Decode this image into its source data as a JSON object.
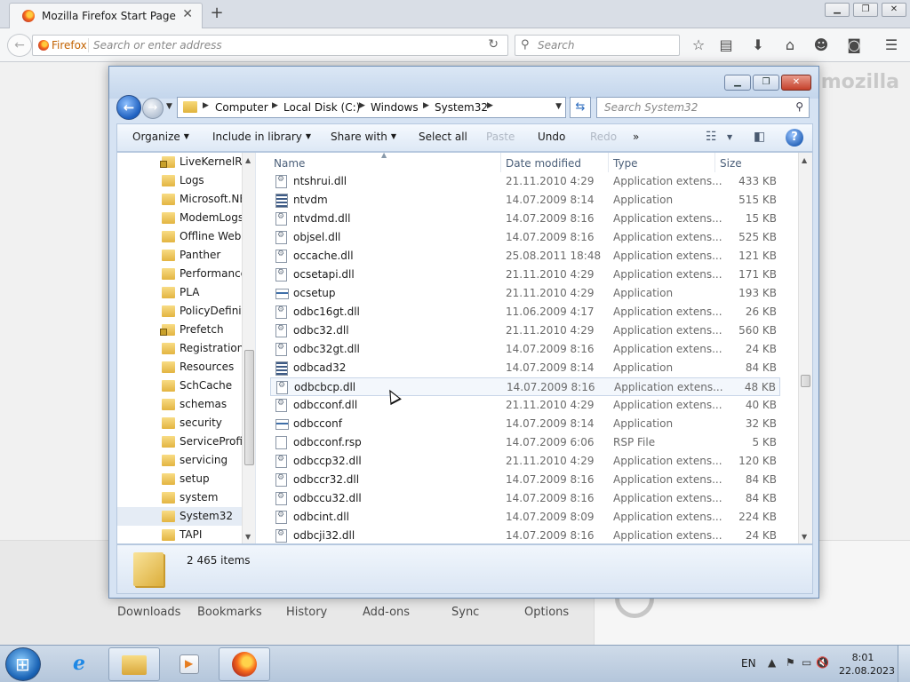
{
  "firefox": {
    "tab_title": "Mozilla Firefox Start Page",
    "identity_label": "Firefox",
    "url_placeholder": "Search or enter address",
    "search_placeholder": "Search",
    "brand": "mozilla",
    "launch": [
      "Downloads",
      "Bookmarks",
      "History",
      "Add-ons",
      "Sync",
      "Options"
    ]
  },
  "explorer": {
    "breadcrumb": [
      "Computer",
      "Local Disk (C:)",
      "Windows",
      "System32"
    ],
    "search_placeholder": "Search System32",
    "commands": {
      "organize": "Organize",
      "include": "Include in library",
      "share": "Share with",
      "select_all": "Select all",
      "paste": "Paste",
      "undo": "Undo",
      "redo": "Redo",
      "more": "»"
    },
    "nav_items": [
      {
        "label": "LiveKernelRep",
        "locked": true
      },
      {
        "label": "Logs",
        "locked": false
      },
      {
        "label": "Microsoft.NE",
        "locked": false
      },
      {
        "label": "ModemLogs",
        "locked": false
      },
      {
        "label": "Offline Web P",
        "locked": false
      },
      {
        "label": "Panther",
        "locked": false
      },
      {
        "label": "Performance",
        "locked": false
      },
      {
        "label": "PLA",
        "locked": false
      },
      {
        "label": "PolicyDefiniti",
        "locked": false
      },
      {
        "label": "Prefetch",
        "locked": true
      },
      {
        "label": "Registration",
        "locked": false
      },
      {
        "label": "Resources",
        "locked": false
      },
      {
        "label": "SchCache",
        "locked": false
      },
      {
        "label": "schemas",
        "locked": false
      },
      {
        "label": "security",
        "locked": false
      },
      {
        "label": "ServiceProfile",
        "locked": false
      },
      {
        "label": "servicing",
        "locked": false
      },
      {
        "label": "setup",
        "locked": false
      },
      {
        "label": "system",
        "locked": false
      },
      {
        "label": "System32",
        "locked": false,
        "selected": true
      },
      {
        "label": "TAPI",
        "locked": false
      }
    ],
    "columns": {
      "name": "Name",
      "date": "Date modified",
      "type": "Type",
      "size": "Size"
    },
    "files": [
      {
        "name": "ntshrui.dll",
        "date": "21.11.2010 4:29",
        "type": "Application extens...",
        "size": "433 KB",
        "icon": "dll"
      },
      {
        "name": "ntvdm",
        "date": "14.07.2009 8:14",
        "type": "Application",
        "size": "515 KB",
        "icon": "appbig"
      },
      {
        "name": "ntvdmd.dll",
        "date": "14.07.2009 8:16",
        "type": "Application extens...",
        "size": "15 KB",
        "icon": "dll"
      },
      {
        "name": "objsel.dll",
        "date": "14.07.2009 8:16",
        "type": "Application extens...",
        "size": "525 KB",
        "icon": "dll"
      },
      {
        "name": "occache.dll",
        "date": "25.08.2011 18:48",
        "type": "Application extens...",
        "size": "121 KB",
        "icon": "dll"
      },
      {
        "name": "ocsetapi.dll",
        "date": "21.11.2010 4:29",
        "type": "Application extens...",
        "size": "171 KB",
        "icon": "dll"
      },
      {
        "name": "ocsetup",
        "date": "21.11.2010 4:29",
        "type": "Application",
        "size": "193 KB",
        "icon": "app"
      },
      {
        "name": "odbc16gt.dll",
        "date": "11.06.2009 4:17",
        "type": "Application extens...",
        "size": "26 KB",
        "icon": "dll"
      },
      {
        "name": "odbc32.dll",
        "date": "21.11.2010 4:29",
        "type": "Application extens...",
        "size": "560 KB",
        "icon": "dll"
      },
      {
        "name": "odbc32gt.dll",
        "date": "14.07.2009 8:16",
        "type": "Application extens...",
        "size": "24 KB",
        "icon": "dll"
      },
      {
        "name": "odbcad32",
        "date": "14.07.2009 8:14",
        "type": "Application",
        "size": "84 KB",
        "icon": "appbig"
      },
      {
        "name": "odbcbcp.dll",
        "date": "14.07.2009 8:16",
        "type": "Application extens...",
        "size": "48 KB",
        "icon": "dll",
        "hover": true
      },
      {
        "name": "odbcconf.dll",
        "date": "21.11.2010 4:29",
        "type": "Application extens...",
        "size": "40 KB",
        "icon": "dll"
      },
      {
        "name": "odbcconf",
        "date": "14.07.2009 8:14",
        "type": "Application",
        "size": "32 KB",
        "icon": "app"
      },
      {
        "name": "odbcconf.rsp",
        "date": "14.07.2009 6:06",
        "type": "RSP File",
        "size": "5 KB",
        "icon": "rsp"
      },
      {
        "name": "odbccp32.dll",
        "date": "21.11.2010 4:29",
        "type": "Application extens...",
        "size": "120 KB",
        "icon": "dll"
      },
      {
        "name": "odbccr32.dll",
        "date": "14.07.2009 8:16",
        "type": "Application extens...",
        "size": "84 KB",
        "icon": "dll"
      },
      {
        "name": "odbccu32.dll",
        "date": "14.07.2009 8:16",
        "type": "Application extens...",
        "size": "84 KB",
        "icon": "dll"
      },
      {
        "name": "odbcint.dll",
        "date": "14.07.2009 8:09",
        "type": "Application extens...",
        "size": "224 KB",
        "icon": "dll"
      },
      {
        "name": "odbcji32.dll",
        "date": "14.07.2009 8:16",
        "type": "Application extens...",
        "size": "24 KB",
        "icon": "dll"
      }
    ],
    "item_count": "2 465 items"
  },
  "taskbar": {
    "lang": "EN",
    "time": "8:01",
    "date": "22.08.2023"
  }
}
